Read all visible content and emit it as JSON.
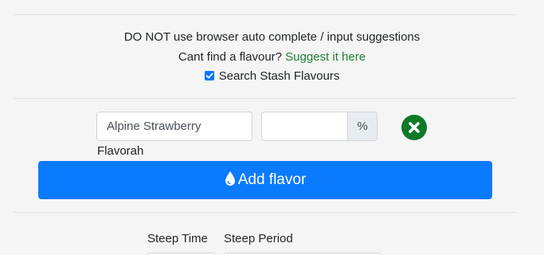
{
  "notice": {
    "text": "DO NOT use browser auto complete / input suggestions",
    "cant_find": "Cant find a flavour?",
    "suggest_link": "Suggest it here",
    "search_stash_label": "Search Stash Flavours",
    "search_stash_checked": true
  },
  "flavor_row": {
    "flavor_value": "Alpine Strawberry",
    "vendor": "Flavorah",
    "percent_value": "",
    "percent_symbol": "%",
    "remove_icon": "close-circle-icon"
  },
  "add_button": {
    "label": "Add flavor",
    "icon": "droplet-icon"
  },
  "steep": {
    "time_label": "Steep Time",
    "period_label": "Steep Period"
  },
  "colors": {
    "primary": "#0a7bff",
    "success": "#0e7a28",
    "link": "#1e7e34"
  }
}
